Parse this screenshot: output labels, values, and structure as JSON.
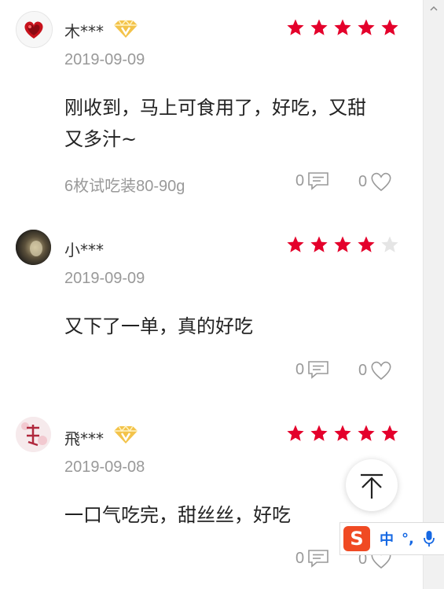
{
  "reviews": [
    {
      "username": "木***",
      "vip": true,
      "rating": 5,
      "date": "2019-09-09",
      "content_line1": "刚收到，马上可食用了，好吃，又甜",
      "content_line2": "又多汁~",
      "spec": "6枚试吃装80-90g",
      "comments": "0",
      "likes": "0"
    },
    {
      "username": "小***",
      "vip": false,
      "rating": 4,
      "date": "2019-09-09",
      "content_line1": "又下了一单，真的好吃",
      "comments": "0",
      "likes": "0"
    },
    {
      "username": "飛***",
      "vip": true,
      "rating": 5,
      "date": "2019-09-08",
      "content_line1": "一口气吃完，甜丝丝，好吃",
      "comments": "0",
      "likes": "0"
    }
  ],
  "ime": {
    "logo": "S",
    "mode": "中",
    "punct": "°,"
  },
  "colors": {
    "star_active": "#e4002b",
    "star_inactive": "#e5e5e5",
    "meta_text": "#999999",
    "vip_gold": "#f3c34a",
    "ime_blue": "#1668e3",
    "ime_brand": "#f04a23"
  },
  "icons": {
    "comment": "comment-bubble-icon",
    "like": "heart-outline-icon",
    "back_to_top": "arrow-up-to-top-icon",
    "vip": "vip-badge-icon",
    "mic": "microphone-icon"
  }
}
